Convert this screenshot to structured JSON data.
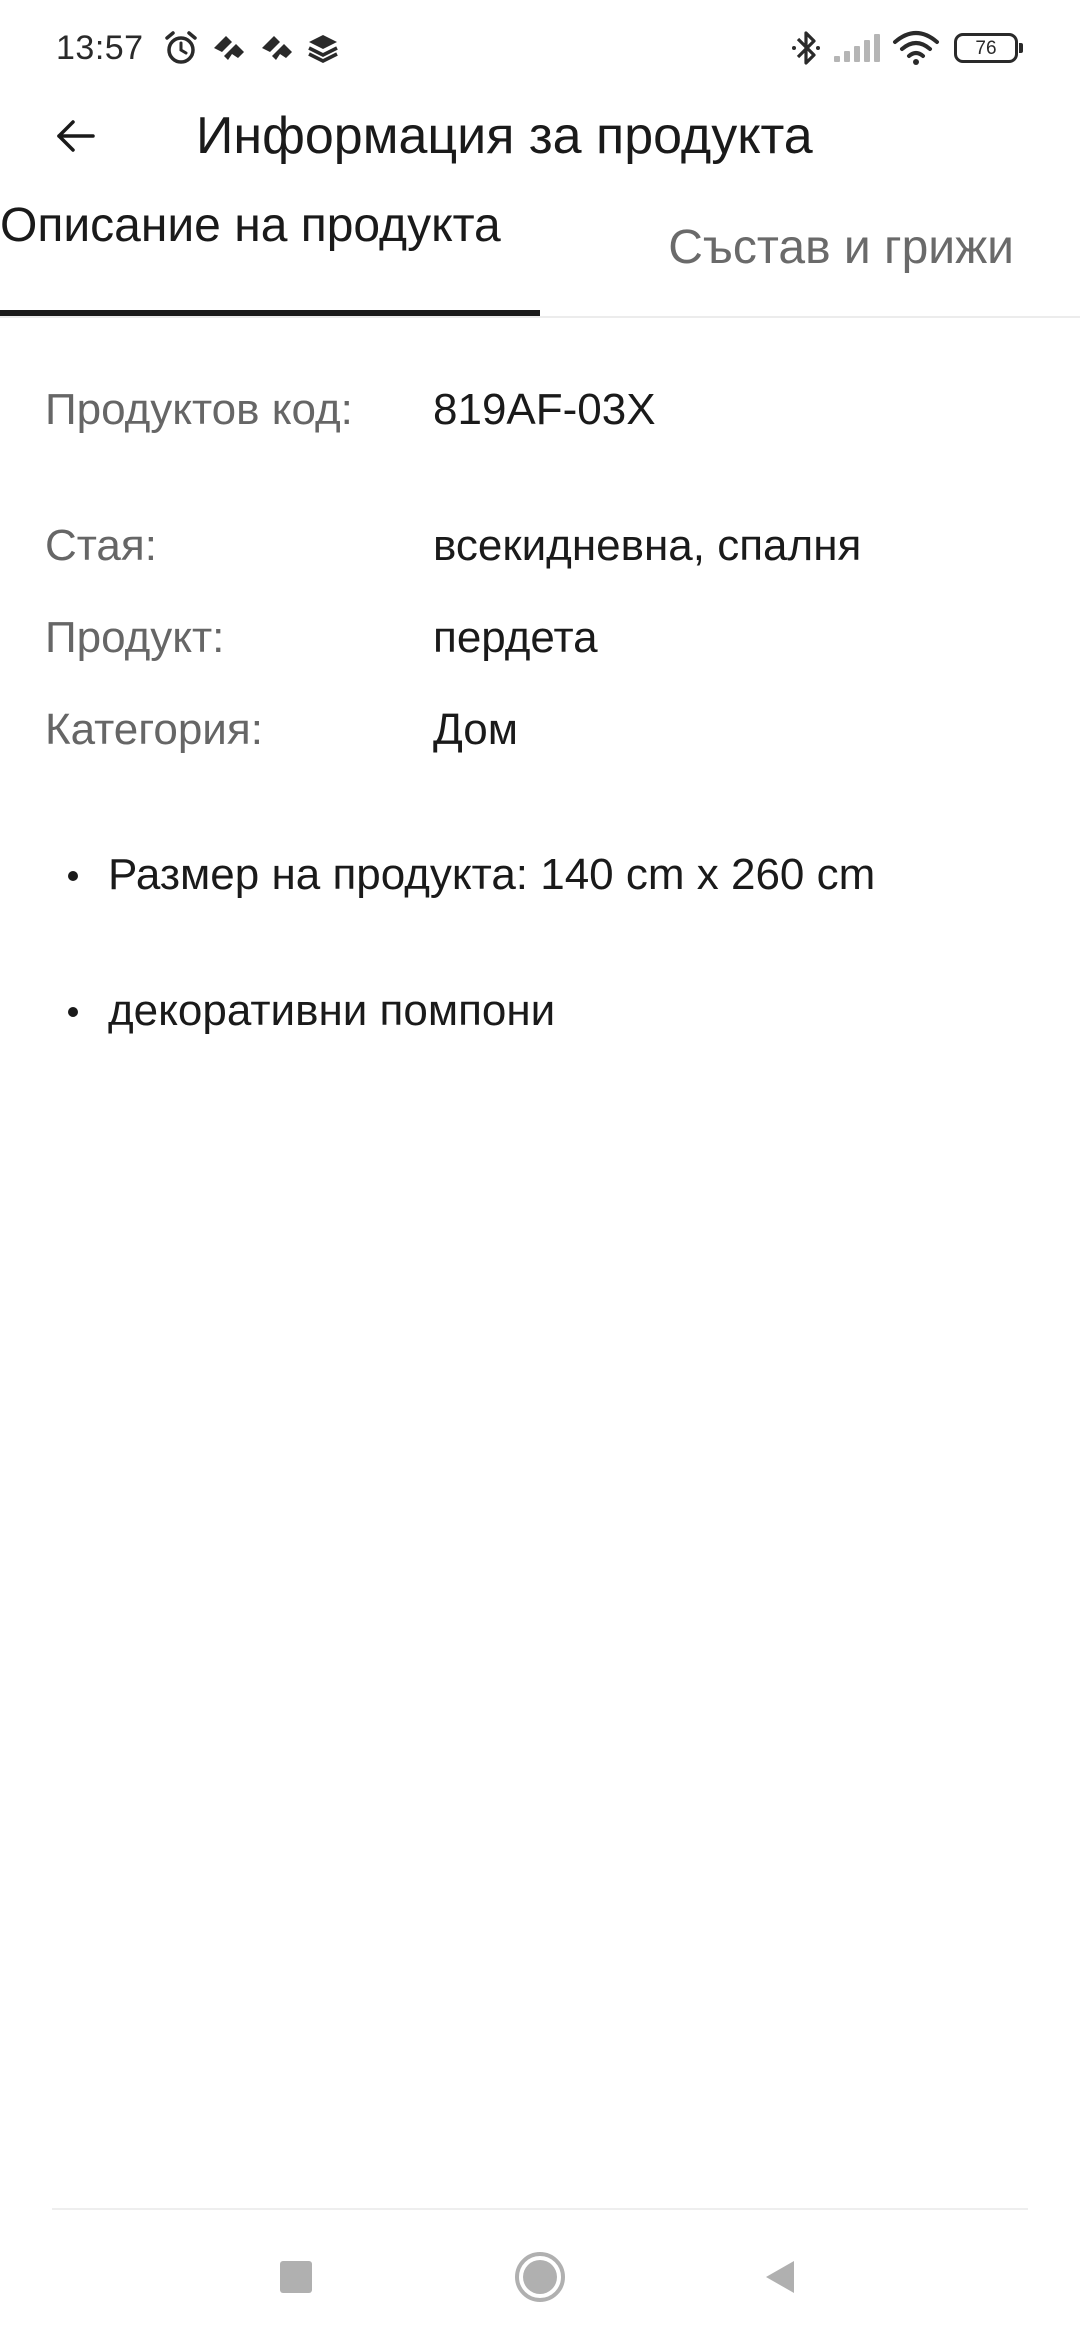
{
  "status_bar": {
    "time": "13:57",
    "battery_level": "76",
    "left_icons": [
      "alarm-icon",
      "app-notification-icon",
      "app-notification-icon",
      "layers-app-icon"
    ],
    "right_icons": [
      "bluetooth-icon",
      "cellular-signal-icon",
      "wifi-icon",
      "battery-icon"
    ]
  },
  "header": {
    "title": "Информация за продукта",
    "back_icon": "arrow-left-icon"
  },
  "tabs": [
    {
      "label": "Описание на продукта",
      "active": true
    },
    {
      "label": "Състав и грижи",
      "active": false
    }
  ],
  "details": [
    {
      "label": "Продуктов код:",
      "value": "819AF-03X"
    },
    {
      "label": "Стая:",
      "value": "всекидневна, спалня"
    },
    {
      "label": "Продукт:",
      "value": "пердета"
    },
    {
      "label": "Категория:",
      "value": "Дом"
    }
  ],
  "features": [
    "Размер на продукта: 140 cm x 260 cm",
    "декоративни помпони"
  ],
  "nav_bar": {
    "buttons": [
      "recents-square-icon",
      "home-circle-icon",
      "back-triangle-icon"
    ]
  },
  "colors": {
    "text_primary": "#1a1a1a",
    "text_secondary": "#666666",
    "tab_inactive": "#6a6a6a",
    "tab_indicator": "#1a1a1a",
    "nav_icons": "#b0b0b0",
    "background": "#ffffff"
  }
}
